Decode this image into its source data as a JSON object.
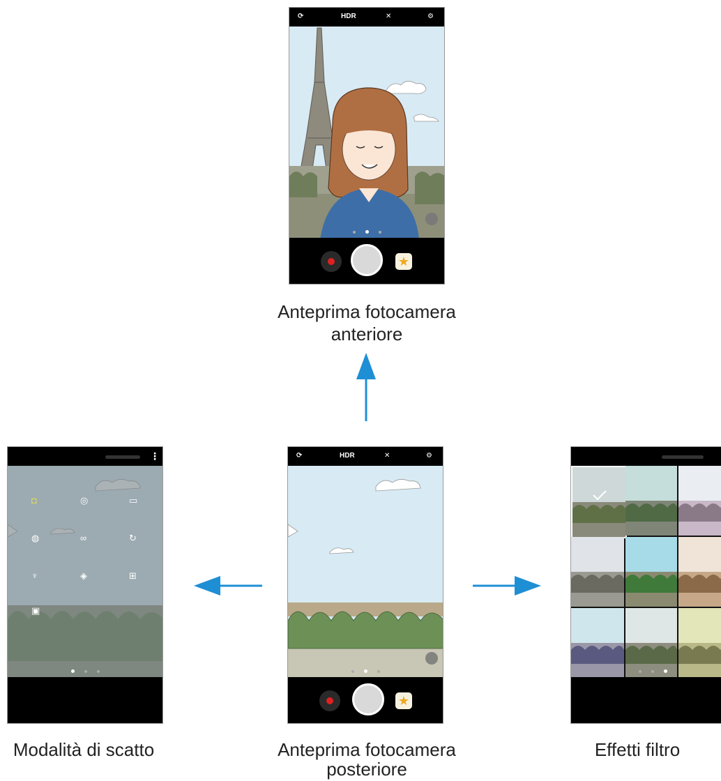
{
  "top_icons": {
    "switch": "⟳",
    "hdr": "HDR",
    "flash": "✕",
    "settings": "⚙"
  },
  "captions": {
    "front_line1": "Anteprima fotocamera",
    "front_line2": "anteriore",
    "rear_line1": "Anteprima fotocamera",
    "rear_line2": "posteriore",
    "modes": "Modalità di scatto",
    "filters": "Effetti filtro"
  },
  "menu_icon": "⋮",
  "star_icon": "★",
  "colors": {
    "arrow": "#1e8fd4",
    "sky": "#d8eaf4",
    "record": "#e02020",
    "bar": "#000000"
  },
  "icons": [
    "camera-switch-icon",
    "hdr-icon",
    "flash-off-icon",
    "settings-icon",
    "record-icon",
    "shutter-icon",
    "effects-star-icon",
    "arrow-up-icon",
    "arrow-left-icon",
    "arrow-right-icon"
  ]
}
